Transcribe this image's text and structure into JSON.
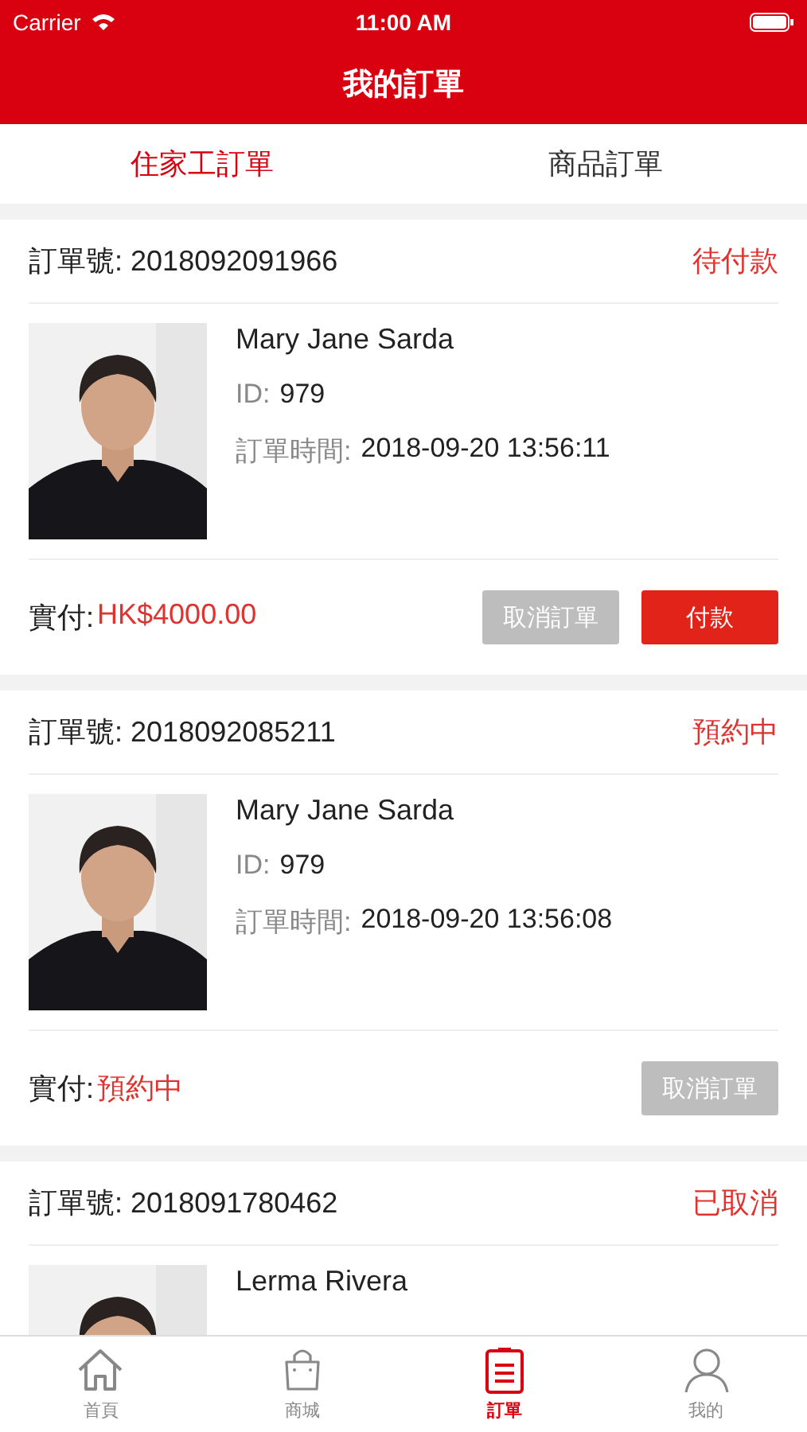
{
  "status_bar": {
    "carrier": "Carrier",
    "time": "11:00 AM"
  },
  "nav": {
    "title": "我的訂單"
  },
  "tabs": [
    {
      "label": "住家工訂單",
      "selected": true
    },
    {
      "label": "商品訂單",
      "selected": false
    }
  ],
  "orders": [
    {
      "number_label": "訂單號:",
      "number": "2018092091966",
      "status": "待付款",
      "photo": {
        "kind": "picture"
      },
      "name": "Mary Jane Sarda",
      "id_label": "ID:",
      "id": "979",
      "time_label": "訂單時間:",
      "time": "2018-09-20 13:56:11",
      "total_label": "實付:",
      "total": "HK$4000.00",
      "buttons": [
        {
          "label": "取消訂單",
          "kind": "cancel"
        },
        {
          "label": "付款",
          "kind": "pay"
        }
      ]
    },
    {
      "number_label": "訂單號:",
      "number": "2018092085211",
      "status": "預約中",
      "photo": {
        "kind": "picture"
      },
      "name": "Mary Jane Sarda",
      "id_label": "ID:",
      "id": "979",
      "time_label": "訂單時間:",
      "time": "2018-09-20 13:56:08",
      "total_label": "實付:",
      "total": "預約中",
      "buttons": [
        {
          "label": "取消訂單",
          "kind": "cancel"
        }
      ]
    },
    {
      "number_label": "訂單號:",
      "number": "2018091780462",
      "status": "已取消",
      "photo": {
        "kind": "picture"
      },
      "name": "Lerma Rivera"
    }
  ],
  "tab_bar": [
    {
      "label": "首頁",
      "kind": "home",
      "selected": false
    },
    {
      "label": "商城",
      "kind": "shop",
      "selected": false
    },
    {
      "label": "訂單",
      "kind": "orders",
      "selected": true
    },
    {
      "label": "我的",
      "kind": "profile",
      "selected": false
    }
  ]
}
